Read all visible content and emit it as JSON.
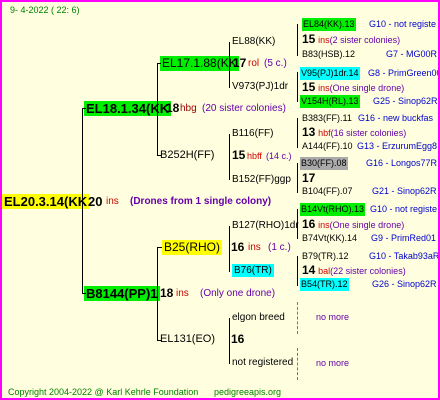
{
  "header": "9-   4-2022  (  22:   6)",
  "footer": {
    "copyright": "Copyright 2004-2022 @ Karl Kehrle Foundation",
    "site": "pedigreeapis.org"
  },
  "root": {
    "id": "EL20.3.14(KK",
    "num": "20",
    "suffix": "ins",
    "note": "(Drones from 1 single colony)"
  },
  "gen1": [
    {
      "id": "EL18.1.34(KK",
      "num": "18",
      "suffix": "hbg",
      "note": "(20 sister colonies)"
    },
    {
      "id": "B8144(PP)1",
      "num": "18",
      "suffix": "ins",
      "note": "(Only one drone)"
    }
  ],
  "gen2": [
    {
      "id": "EL17.1.88(KK",
      "num": "17",
      "suffix": "rol",
      "note": "(5 c.)"
    },
    {
      "id": "B252H(FF)",
      "num": "15",
      "suffix": "hbff",
      "note": "(14 c.)"
    },
    {
      "id": "B25(RHO)",
      "num": "16",
      "suffix": "ins",
      "note": "(1 c.)"
    },
    {
      "id": "EL131(EO)",
      "num": "16",
      "suffix": "",
      "note": ""
    }
  ],
  "gen3": [
    {
      "id": "EL88(KK)",
      "num": "",
      "suffix": "",
      "note": ""
    },
    {
      "id": "V973(PJ)1dr",
      "num": "",
      "suffix": "",
      "note": ""
    },
    {
      "id": "B116(FF)",
      "num": "",
      "suffix": "",
      "note": ""
    },
    {
      "id": "B152(FF)ggp",
      "num": "",
      "suffix": "",
      "note": ""
    },
    {
      "id": "B127(RHO)1dr",
      "num": "",
      "suffix": "",
      "note": ""
    },
    {
      "id": "B76(TR)",
      "num": "",
      "suffix": "",
      "note": ""
    },
    {
      "id": "elgon breed",
      "num": "",
      "suffix": "",
      "note": ""
    },
    {
      "id": "not registered",
      "num": "",
      "suffix": "",
      "note": ""
    }
  ],
  "gen4": [
    {
      "id": "EL84(KK).13",
      "num": "",
      "suffix": "",
      "note": "",
      "right": "G10 - not registe"
    },
    {
      "id": "15",
      "num": "",
      "suffix": "ins",
      "note": "(2 sister colonies)",
      "right": ""
    },
    {
      "id": "B83(HSB).12",
      "num": "",
      "suffix": "",
      "note": "",
      "right": "G7 - MG00R"
    },
    {
      "id": "V95(PJ)1dr.14",
      "num": "",
      "suffix": "",
      "note": "",
      "right": "G8 - PrimGreen00"
    },
    {
      "id": "15",
      "num": "",
      "suffix": "ins",
      "note": "(One single drone)",
      "right": ""
    },
    {
      "id": "V154H(RL).13",
      "num": "",
      "suffix": "",
      "note": "",
      "right": "G25 - Sinop62R"
    },
    {
      "id": "B383(FF).11",
      "num": "",
      "suffix": "",
      "note": "",
      "right": "G16 - new buckfas"
    },
    {
      "id": "13",
      "num": "",
      "suffix": "hbf",
      "note": "(16 sister colonies)",
      "right": ""
    },
    {
      "id": "A144(FF).10",
      "num": "",
      "suffix": "",
      "note": "",
      "right": "G13 - ErzurumEgg8"
    },
    {
      "id": "B30(FF).08",
      "num": "",
      "suffix": "",
      "note": "",
      "right": "G16 - Longos77R"
    },
    {
      "id": "17",
      "num": "",
      "suffix": "",
      "note": "",
      "right": ""
    },
    {
      "id": "B104(FF).07",
      "num": "",
      "suffix": "",
      "note": "",
      "right": "G21 - Sinop62R"
    },
    {
      "id": "B14Vt(RHO).13",
      "num": "",
      "suffix": "",
      "note": "",
      "right": "G10 - not registe"
    },
    {
      "id": "16",
      "num": "",
      "suffix": "ins",
      "note": "(One single drone)",
      "right": ""
    },
    {
      "id": "B74Vt(KK).14",
      "num": "",
      "suffix": "",
      "note": "",
      "right": "G9 - PrimRed01"
    },
    {
      "id": "B79(TR).12",
      "num": "",
      "suffix": "",
      "note": "",
      "right": "G10 - Takab93aR"
    },
    {
      "id": "14",
      "num": "",
      "suffix": "bal",
      "note": "(22 sister colonies)",
      "right": ""
    },
    {
      "id": "B54(TR).12",
      "num": "",
      "suffix": "",
      "note": "",
      "right": "G26 - Sinop62R"
    },
    {
      "id": "no more",
      "num": "",
      "suffix": "",
      "note": "",
      "right": ""
    },
    {
      "id": "no more",
      "num": "",
      "suffix": "",
      "note": "",
      "right": ""
    }
  ]
}
